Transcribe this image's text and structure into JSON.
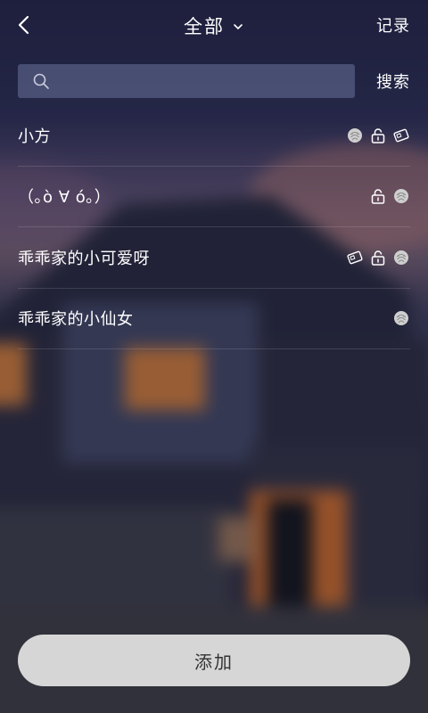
{
  "header": {
    "title": "全部",
    "record_label": "记录"
  },
  "search": {
    "placeholder": "",
    "value": "",
    "button_label": "搜索"
  },
  "items": [
    {
      "name": "小方",
      "icons": [
        "face-icon",
        "lock-icon",
        "card-icon"
      ]
    },
    {
      "name": "（｡ò ∀ ó｡）",
      "icons": [
        "lock-icon",
        "face-icon"
      ]
    },
    {
      "name": "乖乖家的小可爱呀",
      "icons": [
        "card-icon",
        "lock-icon",
        "face-icon"
      ]
    },
    {
      "name": "乖乖家的小仙女",
      "icons": [
        "face-icon"
      ]
    }
  ],
  "add_button": {
    "label": "添加"
  },
  "colors": {
    "text": "#ffffff",
    "search_bg": "#5a6080",
    "divider": "#3a3d55",
    "add_button_bg": "#d6d6d6",
    "add_button_text": "#333333"
  }
}
